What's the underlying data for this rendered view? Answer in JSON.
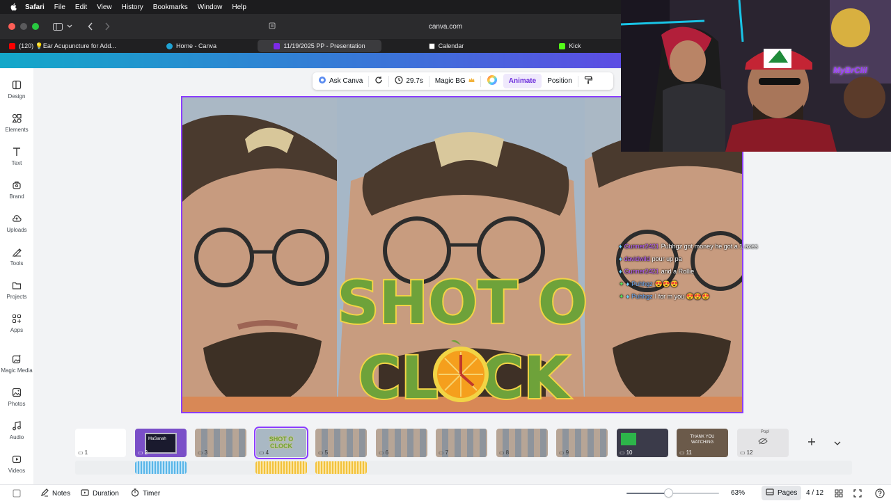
{
  "menubar": {
    "apple_icon": "apple-logo",
    "items": [
      "Safari",
      "File",
      "Edit",
      "View",
      "History",
      "Bookmarks",
      "Window",
      "Help"
    ]
  },
  "toolbar": {
    "address": "canva.com",
    "icons": [
      "sidebar-icon",
      "chevron-down-icon",
      "back-icon",
      "forward-icon",
      "reader-icon"
    ]
  },
  "tabs": [
    {
      "label": "(120) 💡Ear Acupuncture for Add...",
      "favicon_color": "#ff0000"
    },
    {
      "label": "Home - Canva",
      "favicon_color": "#1fa3d4"
    },
    {
      "label": "11/19/2025 PP - Presentation",
      "favicon_color": "#7d2ae8"
    },
    {
      "label": "Calendar",
      "favicon_color": "#ffffff"
    },
    {
      "label": "Kick",
      "favicon_color": "#53fc18"
    }
  ],
  "sidebar": {
    "items": [
      {
        "label": "Design",
        "icon": "design-icon"
      },
      {
        "label": "Elements",
        "icon": "elements-icon"
      },
      {
        "label": "Text",
        "icon": "text-icon"
      },
      {
        "label": "Brand",
        "icon": "brand-icon"
      },
      {
        "label": "Uploads",
        "icon": "uploads-icon"
      },
      {
        "label": "Tools",
        "icon": "tools-icon"
      },
      {
        "label": "Projects",
        "icon": "projects-icon"
      },
      {
        "label": "Apps",
        "icon": "apps-icon"
      },
      {
        "label": "Magic Media",
        "icon": "magic-media-icon"
      },
      {
        "label": "Photos",
        "icon": "photos-icon"
      },
      {
        "label": "Audio",
        "icon": "audio-icon"
      },
      {
        "label": "Videos",
        "icon": "videos-icon"
      }
    ]
  },
  "context_toolbar": {
    "ask_canva": "Ask Canva",
    "duration": "29.7s",
    "magic_bg": "Magic BG",
    "animate": "Animate",
    "position": "Position"
  },
  "slide": {
    "title_line1": "SHOT O",
    "title_line2_a": "CL",
    "title_line2_b": "CK"
  },
  "chat": [
    {
      "user": "Gunner2421",
      "message": "Puhhgz got money he got a 1 axes",
      "user_color": "#b65cff"
    },
    {
      "user": "davidwild",
      "message": "pour up pa",
      "user_color": "#b65cff"
    },
    {
      "user": "Gunner2421",
      "message": "and a Rollie",
      "user_color": "#b65cff"
    },
    {
      "user": "Puhhgz",
      "message": "😍😍😍",
      "user_color": "#6fb1ff"
    },
    {
      "user": "Puhhgz",
      "message": "I for m you 😍😍😍",
      "user_color": "#6fb1ff"
    }
  ],
  "webcam": {
    "overlay_text": "MyBrClil"
  },
  "pages": {
    "thumbnails": [
      {
        "num": "1"
      },
      {
        "num": "2"
      },
      {
        "num": "3"
      },
      {
        "num": "4"
      },
      {
        "num": "5"
      },
      {
        "num": "6"
      },
      {
        "num": "7"
      },
      {
        "num": "8"
      },
      {
        "num": "9"
      },
      {
        "num": "10"
      },
      {
        "num": "11"
      },
      {
        "num": "12"
      }
    ],
    "thumb2_text": "MaSanah",
    "thumb4_text": "SHOT O CLOCK",
    "thumb11_text": "THANK YOU WATCHING",
    "thumb12_text": "Pop!"
  },
  "footer": {
    "notes": "Notes",
    "duration": "Duration",
    "timer": "Timer",
    "zoom": "63%",
    "zoom_level": 0.45,
    "pages": "Pages",
    "page_count": "4 / 12"
  },
  "colors": {
    "accent": "#8b3dff",
    "title_green": "#6ea23a",
    "title_outline": "#f2d445"
  }
}
